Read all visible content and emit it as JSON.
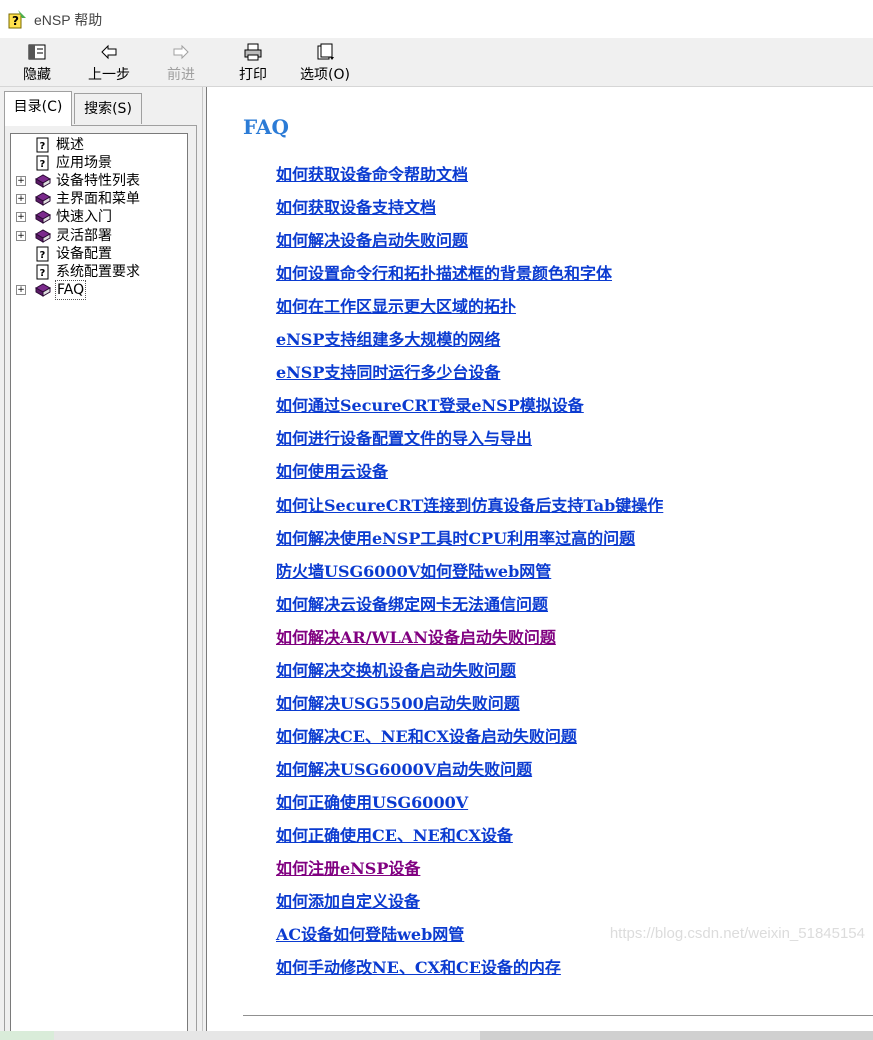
{
  "window": {
    "title": "eNSP 帮助"
  },
  "toolbar": {
    "hide_label": "隐藏",
    "back_label": "上一步",
    "forward_label": "前进",
    "print_label": "打印",
    "options_label": "选项(O)"
  },
  "tabs": {
    "contents_label": "目录(C)",
    "search_label": "搜索(S)"
  },
  "tree": [
    {
      "label": "概述",
      "icon": "help-page-icon",
      "expandable": false
    },
    {
      "label": "应用场景",
      "icon": "help-page-icon",
      "expandable": false
    },
    {
      "label": "设备特性列表",
      "icon": "book-icon",
      "expandable": true
    },
    {
      "label": "主界面和菜单",
      "icon": "book-icon",
      "expandable": true
    },
    {
      "label": "快速入门",
      "icon": "book-icon",
      "expandable": true
    },
    {
      "label": "灵活部署",
      "icon": "book-icon",
      "expandable": true
    },
    {
      "label": "设备配置",
      "icon": "help-page-icon",
      "expandable": false
    },
    {
      "label": "系统配置要求",
      "icon": "help-page-icon",
      "expandable": false
    },
    {
      "label": "FAQ",
      "icon": "book-icon",
      "expandable": true,
      "selected": true
    }
  ],
  "content": {
    "title": "FAQ",
    "links": [
      {
        "text": "如何获取设备命令帮助文档",
        "visited": false
      },
      {
        "text": "如何获取设备支持文档",
        "visited": false
      },
      {
        "text": "如何解决设备启动失败问题",
        "visited": false
      },
      {
        "text": "如何设置命令行和拓扑描述框的背景颜色和字体",
        "visited": false
      },
      {
        "text": "如何在工作区显示更大区域的拓扑",
        "visited": false
      },
      {
        "text": "eNSP支持组建多大规模的网络",
        "visited": false
      },
      {
        "text": "eNSP支持同时运行多少台设备",
        "visited": false
      },
      {
        "text": "如何通过SecureCRT登录eNSP模拟设备",
        "visited": false
      },
      {
        "text": "如何进行设备配置文件的导入与导出",
        "visited": false
      },
      {
        "text": "如何使用云设备",
        "visited": false
      },
      {
        "text": "如何让SecureCRT连接到仿真设备后支持Tab键操作",
        "visited": false
      },
      {
        "text": "如何解决使用eNSP工具时CPU利用率过高的问题",
        "visited": false
      },
      {
        "text": "防火墙USG6000V如何登陆web网管",
        "visited": false
      },
      {
        "text": "如何解决云设备绑定网卡无法通信问题",
        "visited": false
      },
      {
        "text": "如何解决AR/WLAN设备启动失败问题",
        "visited": true
      },
      {
        "text": "如何解决交换机设备启动失败问题",
        "visited": false
      },
      {
        "text": "如何解决USG5500启动失败问题",
        "visited": false
      },
      {
        "text": "如何解决CE、NE和CX设备启动失败问题",
        "visited": false
      },
      {
        "text": "如何解决USG6000V启动失败问题",
        "visited": false
      },
      {
        "text": "如何正确使用USG6000V",
        "visited": false
      },
      {
        "text": "如何正确使用CE、NE和CX设备",
        "visited": false
      },
      {
        "text": "如何注册eNSP设备",
        "visited": true
      },
      {
        "text": "如何添加自定义设备",
        "visited": false
      },
      {
        "text": "AC设备如何登陆web网管",
        "visited": false
      },
      {
        "text": "如何手动修改NE、CX和CE设备的内存",
        "visited": false
      }
    ]
  },
  "watermark": "https://blog.csdn.net/weixin_51845154",
  "colors": {
    "link": "#0b3bd0",
    "visited_link": "#800080",
    "title": "#2b7bd6"
  }
}
